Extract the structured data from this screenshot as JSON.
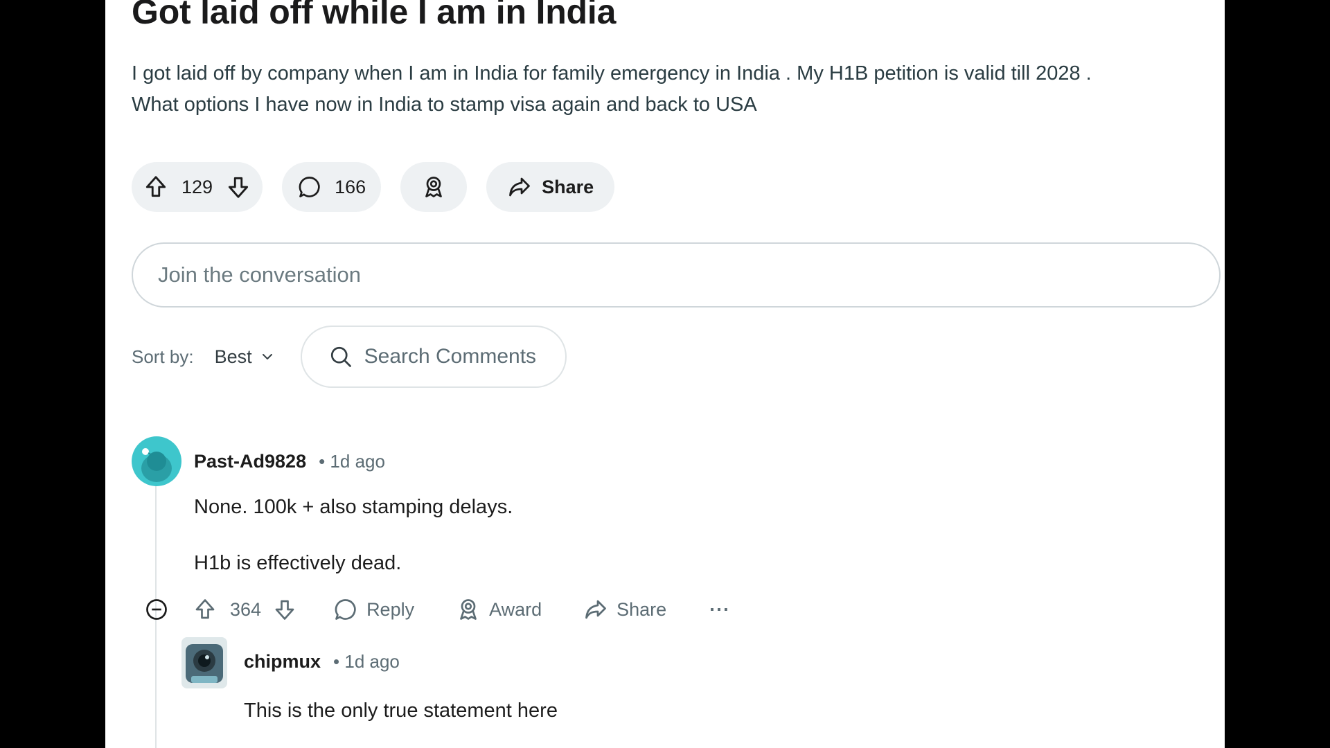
{
  "post": {
    "title": "Got laid off while I am in India",
    "body_line1": "I got laid off by company when I am in India for family emergency in India . My H1B petition is valid till 2028 .",
    "body_line2": "What options I have now in India to stamp visa again and back to USA",
    "vote_count": "129",
    "comment_count": "166",
    "share_label": "Share"
  },
  "composer": {
    "placeholder": "Join the conversation"
  },
  "sort": {
    "label": "Sort by:",
    "selected": "Best",
    "search_placeholder": "Search Comments"
  },
  "comments": [
    {
      "author": "Past-Ad9828",
      "meta": "• 1d ago",
      "paragraph1": "None. 100k + also stamping delays.",
      "paragraph2": "H1b is effectively dead.",
      "votes": "364",
      "reply_label": "Reply",
      "award_label": "Award",
      "share_label": "Share",
      "more_label": "···",
      "avatar_color": "#3ec6cc"
    },
    {
      "author": "chipmux",
      "meta": "• 1d ago",
      "text": "This is the only true statement here"
    }
  ],
  "icons": {
    "upvote": "upvote-icon",
    "downvote": "downvote-icon",
    "comment": "comment-icon",
    "award": "award-icon",
    "share": "share-icon",
    "search": "search-icon",
    "chevron": "chevron-down-icon",
    "collapse": "collapse-icon"
  },
  "colors": {
    "page_bg": "#ffffff",
    "outer_bg": "#000000",
    "pill_bg": "#eef1f3",
    "muted_text": "#5c6c74"
  }
}
